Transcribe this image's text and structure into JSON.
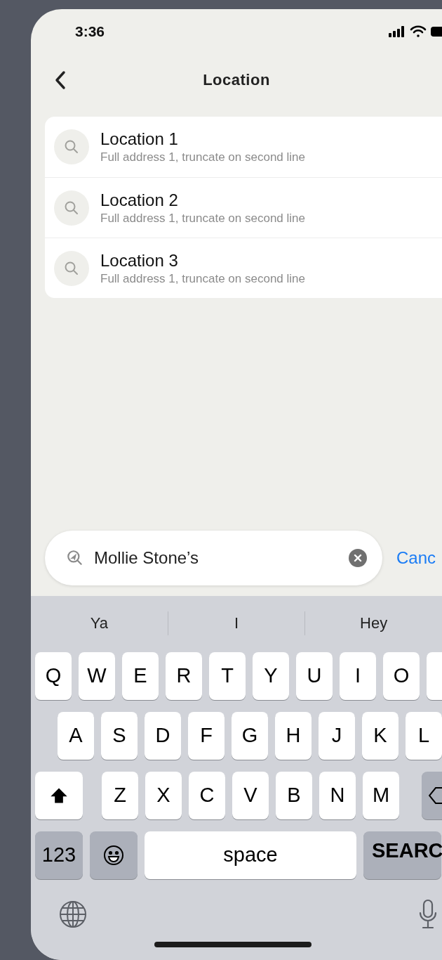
{
  "status_bar": {
    "time": "3:36"
  },
  "nav": {
    "title": "Location"
  },
  "results": [
    {
      "title": "Location 1",
      "address": "Full address 1, truncate on second line"
    },
    {
      "title": "Location 2",
      "address": "Full address 1, truncate on second line"
    },
    {
      "title": "Location 3",
      "address": "Full address 1, truncate on second line"
    }
  ],
  "search": {
    "value": "Mollie Stone’s",
    "cancel": "Canc"
  },
  "keyboard": {
    "suggestions": [
      "Ya",
      "I",
      "Hey"
    ],
    "rows": [
      {
        "keys": [
          {
            "kind": "letter",
            "label": "Q"
          },
          {
            "kind": "letter",
            "label": "W"
          },
          {
            "kind": "letter",
            "label": "E"
          },
          {
            "kind": "letter",
            "label": "R"
          },
          {
            "kind": "letter",
            "label": "T"
          },
          {
            "kind": "letter",
            "label": "Y"
          },
          {
            "kind": "letter",
            "label": "U"
          },
          {
            "kind": "letter",
            "label": "I"
          },
          {
            "kind": "letter",
            "label": "O"
          },
          {
            "kind": "blank"
          }
        ]
      },
      {
        "keys": [
          {
            "kind": "letter",
            "label": "A"
          },
          {
            "kind": "letter",
            "label": "S"
          },
          {
            "kind": "letter",
            "label": "D"
          },
          {
            "kind": "letter",
            "label": "F"
          },
          {
            "kind": "letter",
            "label": "G"
          },
          {
            "kind": "letter",
            "label": "H"
          },
          {
            "kind": "letter",
            "label": "J"
          },
          {
            "kind": "letter",
            "label": "K"
          },
          {
            "kind": "letter",
            "label": "L"
          }
        ]
      },
      {
        "keys": [
          {
            "kind": "shift"
          },
          {
            "kind": "letter",
            "label": "Z"
          },
          {
            "kind": "letter",
            "label": "X"
          },
          {
            "kind": "letter",
            "label": "C"
          },
          {
            "kind": "letter",
            "label": "V"
          },
          {
            "kind": "letter",
            "label": "B"
          },
          {
            "kind": "letter",
            "label": "N"
          },
          {
            "kind": "letter",
            "label": "M"
          },
          {
            "kind": "backspace"
          }
        ]
      },
      {
        "keys": [
          {
            "kind": "mode",
            "label": "123"
          },
          {
            "kind": "emoji"
          },
          {
            "kind": "space",
            "label": "space"
          },
          {
            "kind": "action",
            "label": "SEARC"
          }
        ]
      }
    ]
  }
}
